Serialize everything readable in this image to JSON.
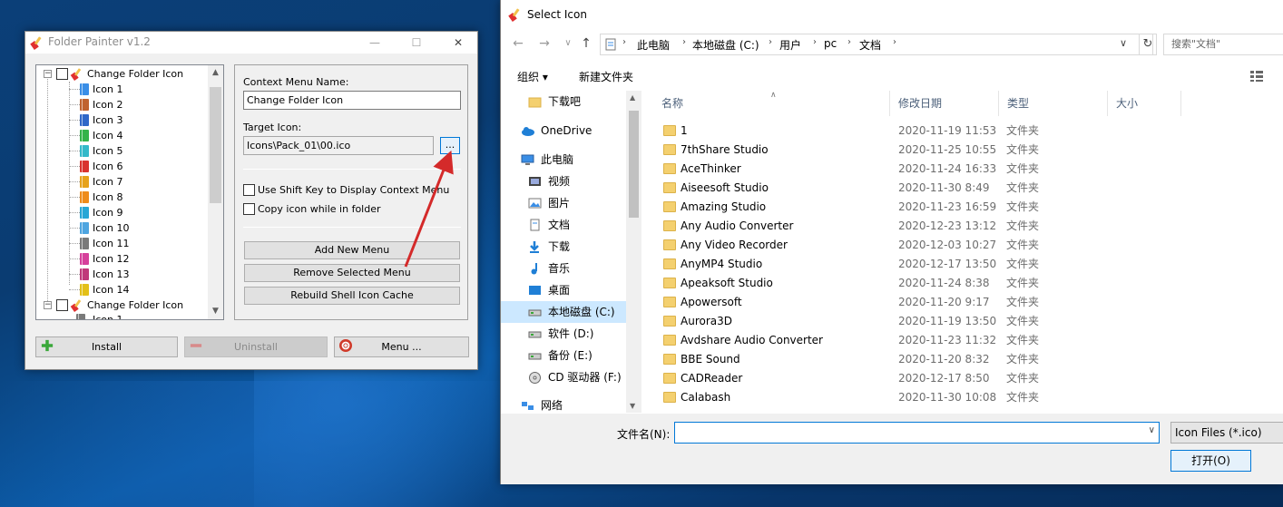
{
  "folder_painter": {
    "title": "Folder Painter v1.2",
    "min_glyph": "—",
    "max_glyph": "☐",
    "close_glyph": "✕",
    "tree": {
      "group1_label": "Change Folder Icon",
      "icons": [
        {
          "label": "Icon 1",
          "color": "#3a8ee6"
        },
        {
          "label": "Icon 2",
          "color": "#c0632f"
        },
        {
          "label": "Icon 3",
          "color": "#2f68c8"
        },
        {
          "label": "Icon 4",
          "color": "#34b34a"
        },
        {
          "label": "Icon 5",
          "color": "#33b9c9"
        },
        {
          "label": "Icon 6",
          "color": "#d9332f"
        },
        {
          "label": "Icon 7",
          "color": "#e6a21c"
        },
        {
          "label": "Icon 8",
          "color": "#ee8c1c"
        },
        {
          "label": "Icon 9",
          "color": "#27a7d6"
        },
        {
          "label": "Icon 10",
          "color": "#4ea5e0"
        },
        {
          "label": "Icon 11",
          "color": "#7a7a7a"
        },
        {
          "label": "Icon 12",
          "color": "#d6409b"
        },
        {
          "label": "Icon 13",
          "color": "#c0397a"
        },
        {
          "label": "Icon 14",
          "color": "#e3c019"
        }
      ],
      "group2_label": "Change Folder Icon",
      "group2_child": "Icon 1"
    },
    "context_menu_name_label": "Context Menu Name:",
    "context_menu_name_value": "Change Folder Icon",
    "target_icon_label": "Target Icon:",
    "target_icon_value": "Icons\\Pack_01\\00.ico",
    "browse_label": "...",
    "shift_key_label": "Use Shift Key to Display Context Menu",
    "copy_icon_label": "Copy icon while in folder",
    "add_menu_label": "Add New Menu",
    "remove_menu_label": "Remove Selected Menu",
    "rebuild_label": "Rebuild Shell Icon Cache",
    "install_label": "Install",
    "uninstall_label": "Uninstall",
    "menu_label": "Menu ..."
  },
  "dialog": {
    "title": "Select Icon",
    "close_glyph": "✕",
    "breadcrumb": [
      "此电脑",
      "本地磁盘 (C:)",
      "用户",
      "pc",
      "文档"
    ],
    "search_placeholder": "搜索\"文档\"",
    "toolbar": {
      "organize": "组织 ▾",
      "new_folder": "新建文件夹"
    },
    "nav_items": [
      {
        "label": "下载吧",
        "icon": "folder-icon"
      },
      {
        "label": "OneDrive",
        "icon": "cloud-icon"
      },
      {
        "label": "此电脑",
        "icon": "computer-icon"
      },
      {
        "label": "视频",
        "icon": "video-icon"
      },
      {
        "label": "图片",
        "icon": "picture-icon"
      },
      {
        "label": "文档",
        "icon": "document-icon"
      },
      {
        "label": "下载",
        "icon": "download-icon"
      },
      {
        "label": "音乐",
        "icon": "music-icon"
      },
      {
        "label": "桌面",
        "icon": "desktop-icon"
      },
      {
        "label": "本地磁盘 (C:)",
        "icon": "drive-icon"
      },
      {
        "label": "软件 (D:)",
        "icon": "drive-icon"
      },
      {
        "label": "备份 (E:)",
        "icon": "drive-icon"
      },
      {
        "label": "CD 驱动器 (F:)",
        "icon": "cd-drive-icon"
      },
      {
        "label": "网络",
        "icon": "network-icon"
      }
    ],
    "columns": {
      "name": "名称",
      "date": "修改日期",
      "type": "类型",
      "size": "大小"
    },
    "files": [
      {
        "name": "1",
        "date": "2020-11-19 11:53",
        "type": "文件夹"
      },
      {
        "name": "7thShare Studio",
        "date": "2020-11-25 10:55",
        "type": "文件夹"
      },
      {
        "name": "AceThinker",
        "date": "2020-11-24 16:33",
        "type": "文件夹"
      },
      {
        "name": "Aiseesoft Studio",
        "date": "2020-11-30 8:49",
        "type": "文件夹"
      },
      {
        "name": "Amazing Studio",
        "date": "2020-11-23 16:59",
        "type": "文件夹"
      },
      {
        "name": "Any Audio Converter",
        "date": "2020-12-23 13:12",
        "type": "文件夹"
      },
      {
        "name": "Any Video Recorder",
        "date": "2020-12-03 10:27",
        "type": "文件夹"
      },
      {
        "name": "AnyMP4 Studio",
        "date": "2020-12-17 13:50",
        "type": "文件夹"
      },
      {
        "name": "Apeaksoft Studio",
        "date": "2020-11-24 8:38",
        "type": "文件夹"
      },
      {
        "name": "Apowersoft",
        "date": "2020-11-20 9:17",
        "type": "文件夹"
      },
      {
        "name": "Aurora3D",
        "date": "2020-11-19 13:50",
        "type": "文件夹"
      },
      {
        "name": "Avdshare Audio Converter",
        "date": "2020-11-23 11:32",
        "type": "文件夹"
      },
      {
        "name": "BBE Sound",
        "date": "2020-11-20 8:32",
        "type": "文件夹"
      },
      {
        "name": "CADReader",
        "date": "2020-12-17 8:50",
        "type": "文件夹"
      },
      {
        "name": "Calabash",
        "date": "2020-11-30 10:08",
        "type": "文件夹"
      }
    ],
    "filename_label": "文件名(N):",
    "filename_value": "",
    "filetype_value": "Icon Files (*.ico)",
    "open_label": "打开(O)"
  },
  "colors": {
    "accent": "#0078d7",
    "arrow": "#d42a2a"
  }
}
